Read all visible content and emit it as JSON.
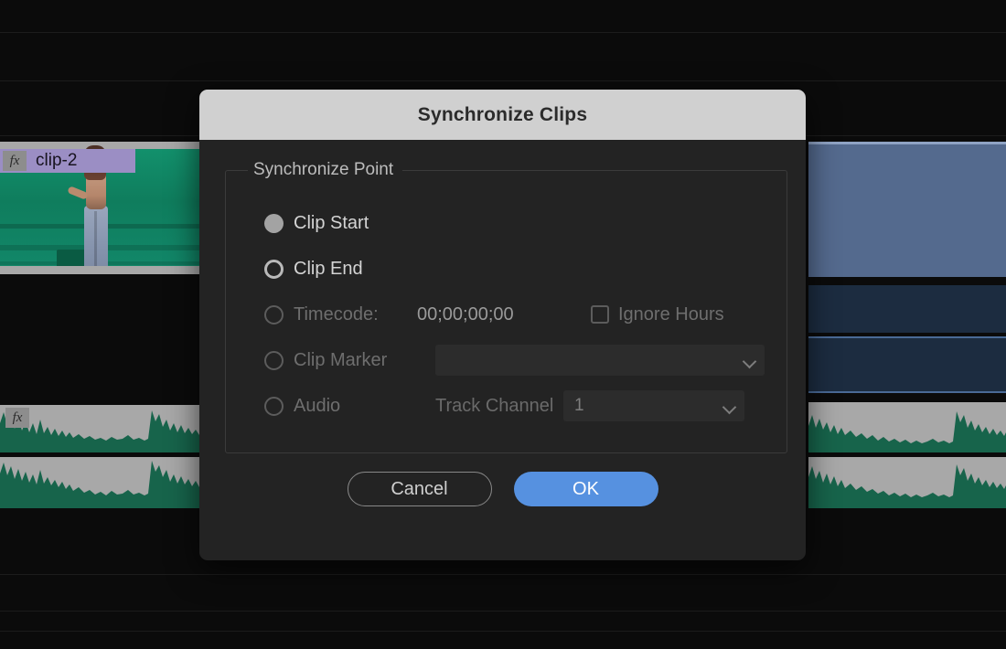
{
  "background": {
    "left_clip": {
      "name": "clip-2",
      "fx_badge": "fx"
    },
    "left_audio_fx_badge": "fx"
  },
  "dialog": {
    "title": "Synchronize Clips",
    "group": {
      "legend": "Synchronize Point"
    },
    "options": [
      {
        "id": "clip-start",
        "label": "Clip Start",
        "state": "filled",
        "enabled": true
      },
      {
        "id": "clip-end",
        "label": "Clip End",
        "state": "ring",
        "enabled": true
      },
      {
        "id": "timecode",
        "label": "Timecode:",
        "state": "disabled-ring",
        "enabled": false
      },
      {
        "id": "clip-marker",
        "label": "Clip Marker",
        "state": "disabled-ring",
        "enabled": false
      },
      {
        "id": "audio",
        "label": "Audio",
        "state": "disabled-ring",
        "enabled": false
      }
    ],
    "timecode": {
      "value": "00;00;00;00",
      "ignore_hours_label": "Ignore Hours",
      "ignore_hours_checked": false
    },
    "clip_marker": {
      "selected": "",
      "placeholder": ""
    },
    "audio": {
      "track_channel_label": "Track Channel",
      "track_channel_value": "1"
    },
    "buttons": {
      "cancel": "Cancel",
      "ok": "OK"
    }
  },
  "colors": {
    "accent_blue": "#5691e0",
    "titlebar": "#d0d0d0",
    "dialog_bg": "#232323",
    "clip_purple": "#9b8ec4",
    "audio_green": "#17644b",
    "video_blue": "#546a8e"
  }
}
